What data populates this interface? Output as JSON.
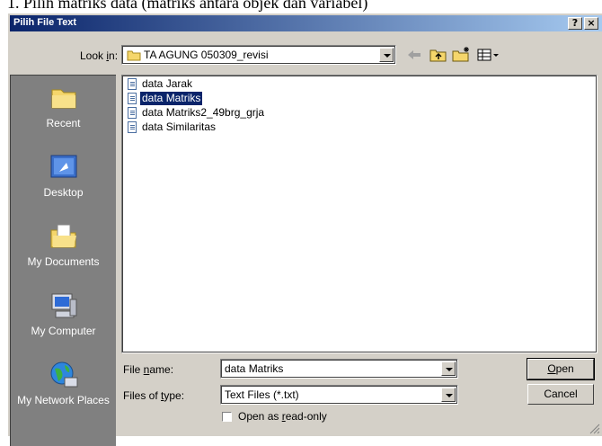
{
  "caption": "1. Pilih matriks data (matriks antara objek dan variabel)",
  "dialog": {
    "title": "Pilih File Text",
    "help_label": "?",
    "close_label": "×"
  },
  "lookin": {
    "label_pre": "Look ",
    "label_u": "i",
    "label_post": "n:",
    "value": "TA AGUNG 050309_revisi"
  },
  "places": [
    {
      "label": "Recent",
      "icon": "recent-folder-icon"
    },
    {
      "label": "Desktop",
      "icon": "desktop-icon"
    },
    {
      "label": "My Documents",
      "icon": "my-documents-icon"
    },
    {
      "label": "My Computer",
      "icon": "my-computer-icon"
    },
    {
      "label": "My Network Places",
      "icon": "network-places-icon"
    }
  ],
  "files": [
    {
      "name": "data Jarak",
      "selected": false
    },
    {
      "name": "data Matriks",
      "selected": true
    },
    {
      "name": "data Matriks2_49brg_grja",
      "selected": false
    },
    {
      "name": "data Similaritas",
      "selected": false
    }
  ],
  "filename": {
    "label_pre": "File ",
    "label_u": "n",
    "label_post": "ame:",
    "value": "data Matriks"
  },
  "filetype": {
    "label_pre": "Files of ",
    "label_u": "t",
    "label_post": "ype:",
    "value": "Text Files (*.txt)"
  },
  "readonly": {
    "label_pre": "Open as ",
    "label_u": "r",
    "label_post": "ead-only",
    "checked": false
  },
  "buttons": {
    "open_u": "O",
    "open_post": "pen",
    "cancel": "Cancel"
  },
  "colors": {
    "title_bar": "#0a246a",
    "selection": "#0a246a",
    "dialog_face": "#d4d0c8",
    "places_bar": "#808080"
  }
}
